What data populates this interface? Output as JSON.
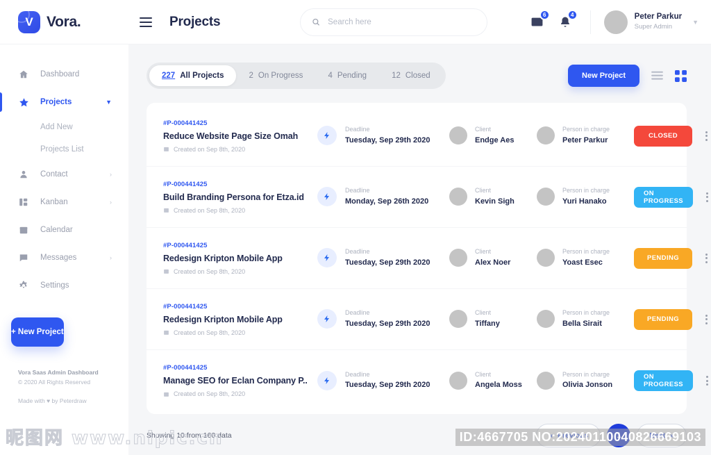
{
  "brand": {
    "name": "Vora.",
    "mark_letter": "V",
    "accent": "#2f57f0"
  },
  "header": {
    "page_title": "Projects",
    "menu_icon": "hamburger-icon",
    "search": {
      "placeholder": "Search here",
      "value": "",
      "icon": "search-icon"
    },
    "mail": {
      "icon": "mail-icon",
      "badge": "6"
    },
    "notifications": {
      "icon": "bell-icon",
      "badge": "4"
    },
    "profile": {
      "name": "Peter Parkur",
      "role": "Super Admin",
      "caret": "chevron-down-icon"
    }
  },
  "sidebar": {
    "items": [
      {
        "label": "Dashboard",
        "icon": "home-icon",
        "active": false,
        "chevron": ""
      },
      {
        "label": "Projects",
        "icon": "star-icon",
        "active": true,
        "chevron": "v"
      },
      {
        "label": "Contact",
        "icon": "user-icon",
        "active": false,
        "chevron": "›"
      },
      {
        "label": "Kanban",
        "icon": "kanban-icon",
        "active": false,
        "chevron": "›"
      },
      {
        "label": "Calendar",
        "icon": "calendar-icon",
        "active": false,
        "chevron": ""
      },
      {
        "label": "Messages",
        "icon": "message-icon",
        "active": false,
        "chevron": "›"
      },
      {
        "label": "Settings",
        "icon": "gear-icon",
        "active": false,
        "chevron": ""
      }
    ],
    "subitems": [
      {
        "label": "Add New"
      },
      {
        "label": "Projects List"
      }
    ],
    "new_project_button": "+ New Project",
    "footer": {
      "line1": "Vora Saas Admin Dashboard",
      "line2": "© 2020 All Rights Reserved",
      "line3": "Made with ♥ by Peterdraw"
    }
  },
  "toolbar": {
    "tabs": [
      {
        "count": "227",
        "label": "All Projects",
        "active": true
      },
      {
        "count": "2",
        "label": "On Progress",
        "active": false
      },
      {
        "count": "4",
        "label": "Pending",
        "active": false
      },
      {
        "count": "12",
        "label": "Closed",
        "active": false
      }
    ],
    "new_project_label": "New Project",
    "view_list_icon": "list-view-icon",
    "view_grid_icon": "grid-view-icon"
  },
  "labels": {
    "deadline": "Deadline",
    "client": "Client",
    "person_in_charge": "Person in charge",
    "created_prefix": "Created on"
  },
  "status_colors": {
    "CLOSED": "#f4483b",
    "ON PROGRESS": "#32b4f5",
    "PENDING": "#f9a825"
  },
  "projects": [
    {
      "id": "#P-000441425",
      "name": "Reduce Website Page Size Omah",
      "created": "Created on Sep 8th, 2020",
      "deadline": "Tuesday,  Sep 29th 2020",
      "client": "Endge Aes",
      "person": "Peter Parkur",
      "status": "CLOSED"
    },
    {
      "id": "#P-000441425",
      "name": "Build Branding Persona for Etza.id",
      "created": "Created on Sep 8th, 2020",
      "deadline": "Monday,  Sep 26th 2020",
      "client": "Kevin Sigh",
      "person": "Yuri Hanako",
      "status": "ON PROGRESS"
    },
    {
      "id": "#P-000441425",
      "name": "Redesign Kripton Mobile App",
      "created": "Created on Sep 8th, 2020",
      "deadline": "Tuesday,  Sep 29th 2020",
      "client": "Alex Noer",
      "person": "Yoast Esec",
      "status": "PENDING"
    },
    {
      "id": "#P-000441425",
      "name": "Redesign Kripton Mobile App",
      "created": "Created on Sep 8th, 2020",
      "deadline": "Tuesday,  Sep 29th 2020",
      "client": "Tiffany",
      "person": "Bella Sirait",
      "status": "PENDING"
    },
    {
      "id": "#P-000441425",
      "name": "Manage SEO for Eclan Company P..",
      "created": "Created on Sep 8th, 2020",
      "deadline": "Tuesday,  Sep 29th 2020",
      "client": "Angela Moss",
      "person": "Olivia Jonson",
      "status": "ON PROGRESS"
    }
  ],
  "footer": {
    "showing": "Showing 10 from 160 data",
    "previous_label": "Previous",
    "previous_icon": "«",
    "page_number": "1",
    "next_label": "Next",
    "next_icon": "»"
  },
  "watermarks": {
    "left": "昵图网 www.nipic.cn",
    "id": "ID:4667705 NO:20240110040826669103"
  }
}
